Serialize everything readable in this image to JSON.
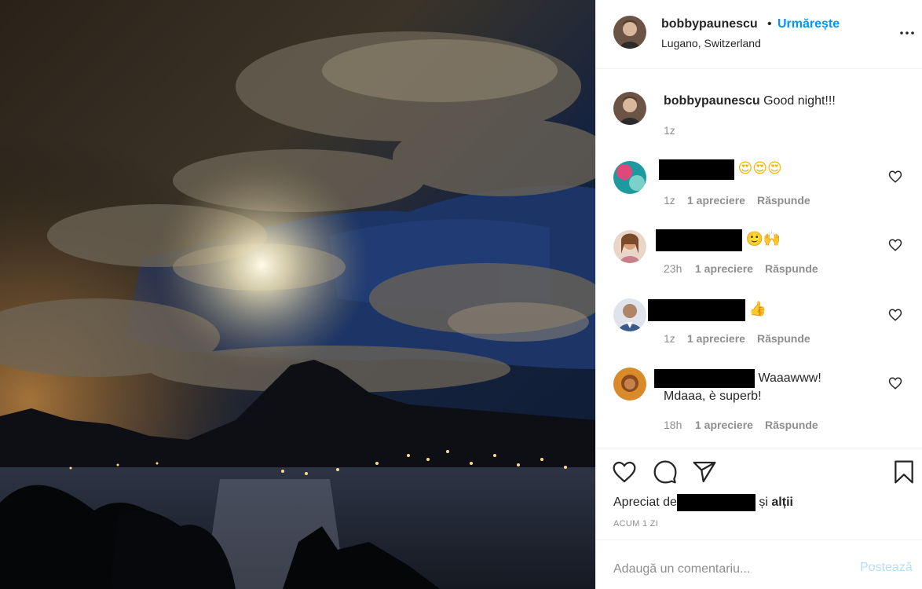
{
  "post": {
    "username": "bobbypaunescu",
    "dot": "•",
    "follow_label": "Urmărește",
    "location": "Lugano, Switzerland",
    "caption_text": "Good night!!!",
    "caption_time": "1z"
  },
  "comments": [
    {
      "emojis": "😍😍😍",
      "time": "1z",
      "likes": "1 apreciere",
      "reply": "Răspunde"
    },
    {
      "emojis": "🙂🙌",
      "time": "23h",
      "likes": "1 apreciere",
      "reply": "Răspunde"
    },
    {
      "emojis": "👍",
      "time": "1z",
      "likes": "1 apreciere",
      "reply": "Răspunde"
    },
    {
      "text_line1": "Waaawww!",
      "text_line2": "Mdaaa, è superb!",
      "time": "18h",
      "likes": "1 apreciere",
      "reply": "Răspunde"
    }
  ],
  "actions": {
    "liked_prefix": "Apreciat de",
    "liked_suffix": "și",
    "liked_others": "alții",
    "timestamp": "ACUM 1 ZI"
  },
  "add_comment": {
    "placeholder": "Adaugă un comentariu...",
    "post_label": "Postează"
  },
  "icons": [
    "more-options-icon",
    "heart-icon",
    "comment-icon",
    "share-icon",
    "bookmark-icon",
    "small-heart-icon"
  ],
  "colors": {
    "link": "#0095f6",
    "muted": "#8e8e8e",
    "post_disabled": "#b2dffc",
    "text": "#262626"
  }
}
